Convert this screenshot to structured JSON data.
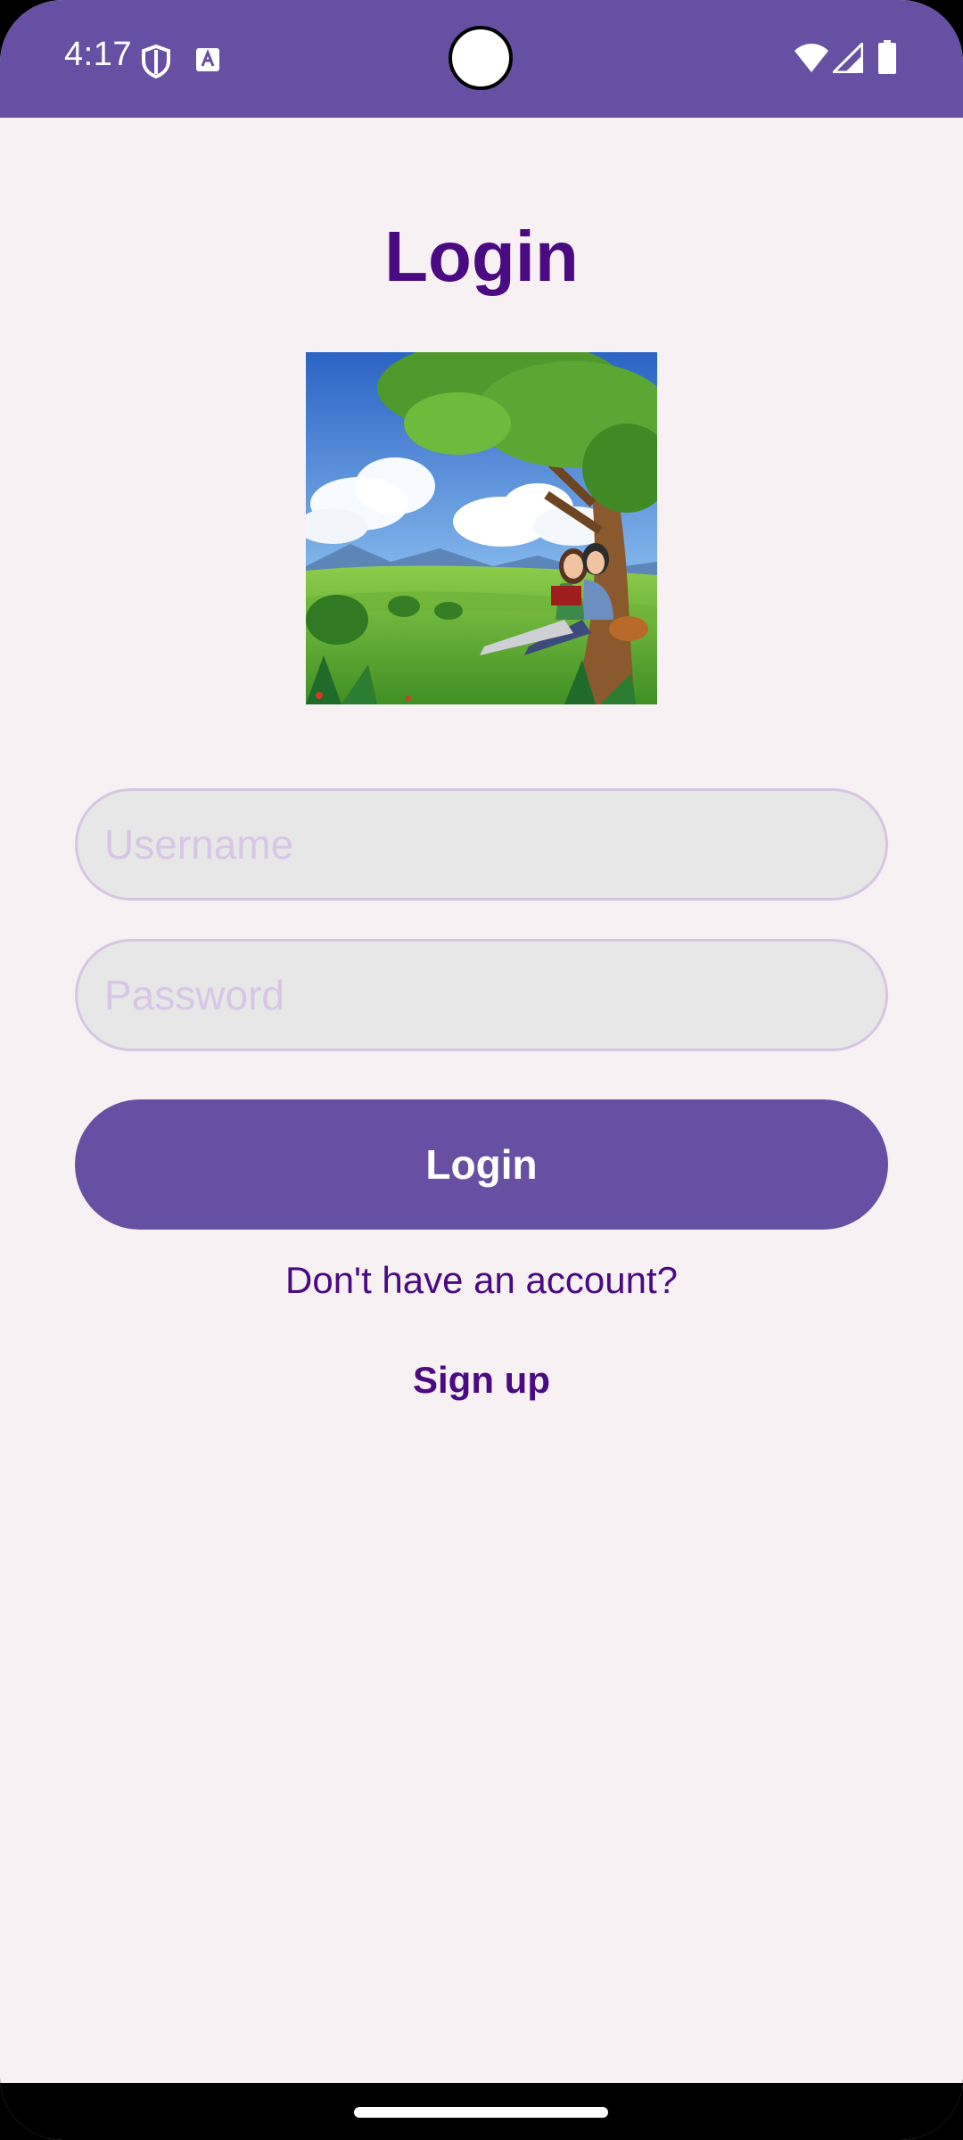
{
  "status_bar": {
    "time": "4:17",
    "left_icons": [
      "shield-icon",
      "translate-icon"
    ],
    "right_icons": [
      "wifi-icon",
      "signal-icon",
      "battery-icon"
    ],
    "color": "#6750a4"
  },
  "login": {
    "title": "Login",
    "image_alt": "illustration-couple-reading-under-tree",
    "username_placeholder": "Username",
    "password_placeholder": "Password",
    "button_label": "Login",
    "no_account_text": "Don't have an account?",
    "signup_label": "Sign up"
  },
  "colors": {
    "primary": "#6750a4",
    "title_text": "#4a0a82",
    "background": "#f8f1f3",
    "input_bg": "#e7e7e8",
    "input_border": "#d6c6e4"
  }
}
